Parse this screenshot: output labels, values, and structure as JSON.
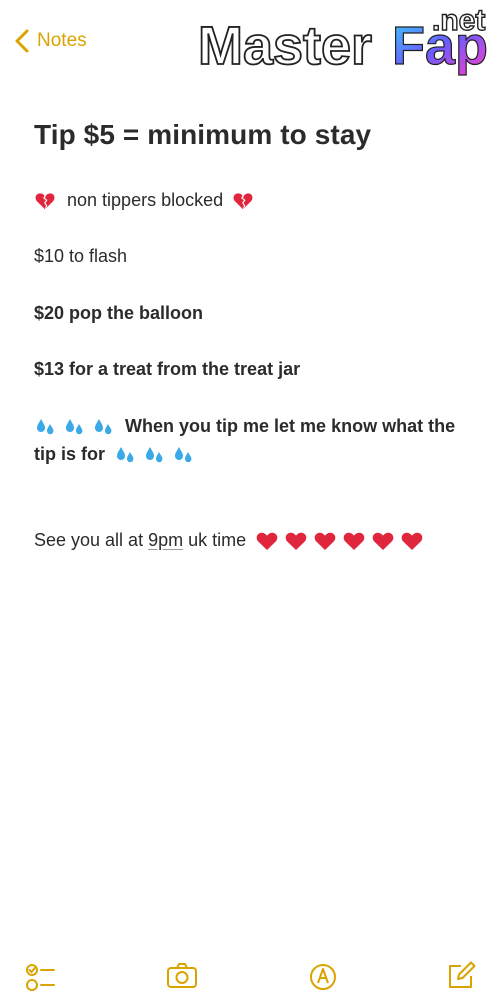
{
  "nav": {
    "back_label": "Notes"
  },
  "watermark": {
    "brand_main": "Master",
    "brand_accent": "Fap",
    "brand_tld": ".net"
  },
  "note": {
    "title": "Tip $5 = minimum to stay",
    "lines": [
      {
        "text": "non tippers blocked",
        "emoji": "broken-heart"
      },
      {
        "text": "$10 to flash"
      },
      {
        "text": "$20 pop the balloon"
      },
      {
        "text": "$13 for a treat from the treat jar"
      },
      {
        "text": "When you tip me let me know what the tip is for",
        "emoji": "sweat-droplets"
      },
      {
        "text_before": "See you all at ",
        "text_link": "9pm",
        "text_after": " uk time",
        "emoji": "red-heart"
      }
    ]
  },
  "toolbar": {
    "items": [
      "checklist-icon",
      "camera-icon",
      "markup-icon",
      "compose-icon"
    ]
  },
  "colors": {
    "accent": "#d9a400",
    "text": "#2b2b2b",
    "broken_heart": "#e0263d",
    "red_heart": "#e0263d",
    "droplet": "#39a9e8"
  }
}
